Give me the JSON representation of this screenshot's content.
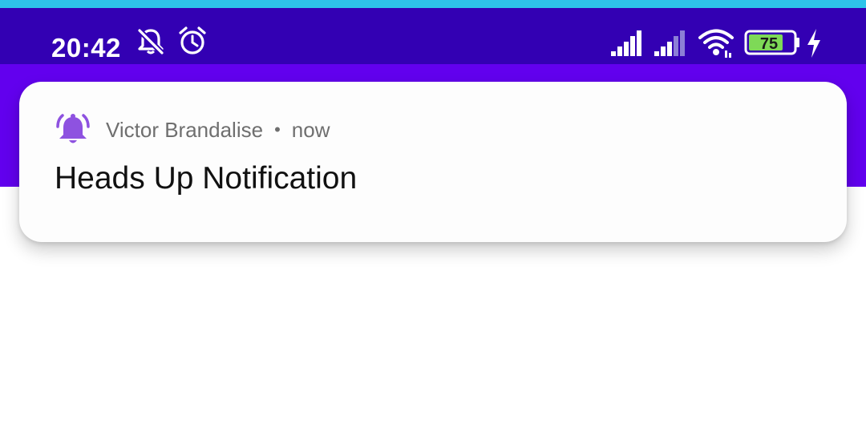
{
  "status_bar": {
    "time": "20:42",
    "icons": [
      "notifications-off-icon",
      "alarm-icon",
      "signal-icon",
      "signal-icon",
      "wifi-icon",
      "battery-icon",
      "charging-bolt-icon"
    ],
    "battery_percent": "75",
    "colors": {
      "background": "#3300b3",
      "accent_strip": "#2ec3ea",
      "battery_fill": "#7ed957"
    }
  },
  "app_bar": {
    "color": "#6200ee"
  },
  "notification": {
    "app_icon": "bell-ringing-icon",
    "app_icon_color": "#8e52e0",
    "app_name": "Victor Brandalise",
    "separator": "•",
    "timestamp": "now",
    "title": "Heads Up Notification"
  }
}
